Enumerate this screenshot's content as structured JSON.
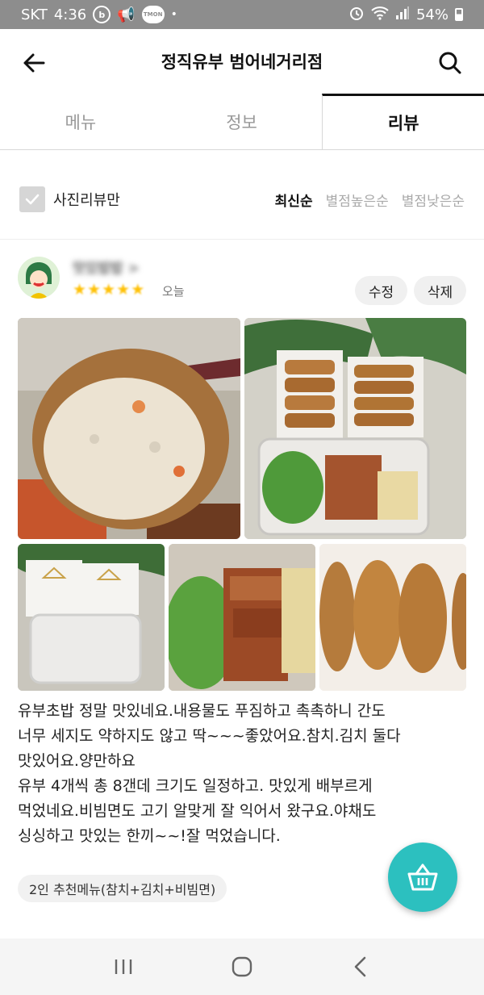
{
  "status_bar": {
    "carrier": "SKT",
    "time": "4:36",
    "battery": "54%",
    "icons": [
      "b-icon",
      "megaphone-icon",
      "tmon-icon",
      "dot",
      "alarm-icon",
      "wifi-icon",
      "signal-icon",
      "battery-icon"
    ],
    "tmon_label": "TMON",
    "b_label": "b"
  },
  "header": {
    "title": "정직유부 범어네거리점"
  },
  "tabs": [
    {
      "label": "메뉴",
      "active": false
    },
    {
      "label": "정보",
      "active": false
    },
    {
      "label": "리뷰",
      "active": true
    }
  ],
  "filter": {
    "photo_only_label": "사진리뷰만",
    "photo_only_checked": false,
    "sort_options": [
      {
        "label": "최신순",
        "active": true
      },
      {
        "label": "별점높은순",
        "active": false
      },
      {
        "label": "별점낮은순",
        "active": false
      }
    ]
  },
  "review": {
    "username": "맛있밥밥 >",
    "rating": 5,
    "date": "오늘",
    "edit_label": "수정",
    "delete_label": "삭제",
    "lines": [
      "유부초밥 정말 맛있네요.내용물도 푸짐하고 촉촉하니 간도",
      "너무 세지도 약하지도 않고 딱~~~좋았어요.참치.김치 둘다",
      "맛있어요.양만하요",
      "유부 4개씩 총 8갠데 크기도 일정하고. 맛있게  배부르게",
      "먹었네요.비빔면도 고기 알맞게 잘 익어서 왔구요.야채도",
      "싱싱하고 맛있는 한끼~~!잘 먹었습니다."
    ],
    "menu_tag": "2인 추천메뉴(참치+김치+비빔면)"
  },
  "colors": {
    "accent": "#2cc0bf",
    "star": "#ffc107",
    "status_bar": "#8d8d8d"
  }
}
